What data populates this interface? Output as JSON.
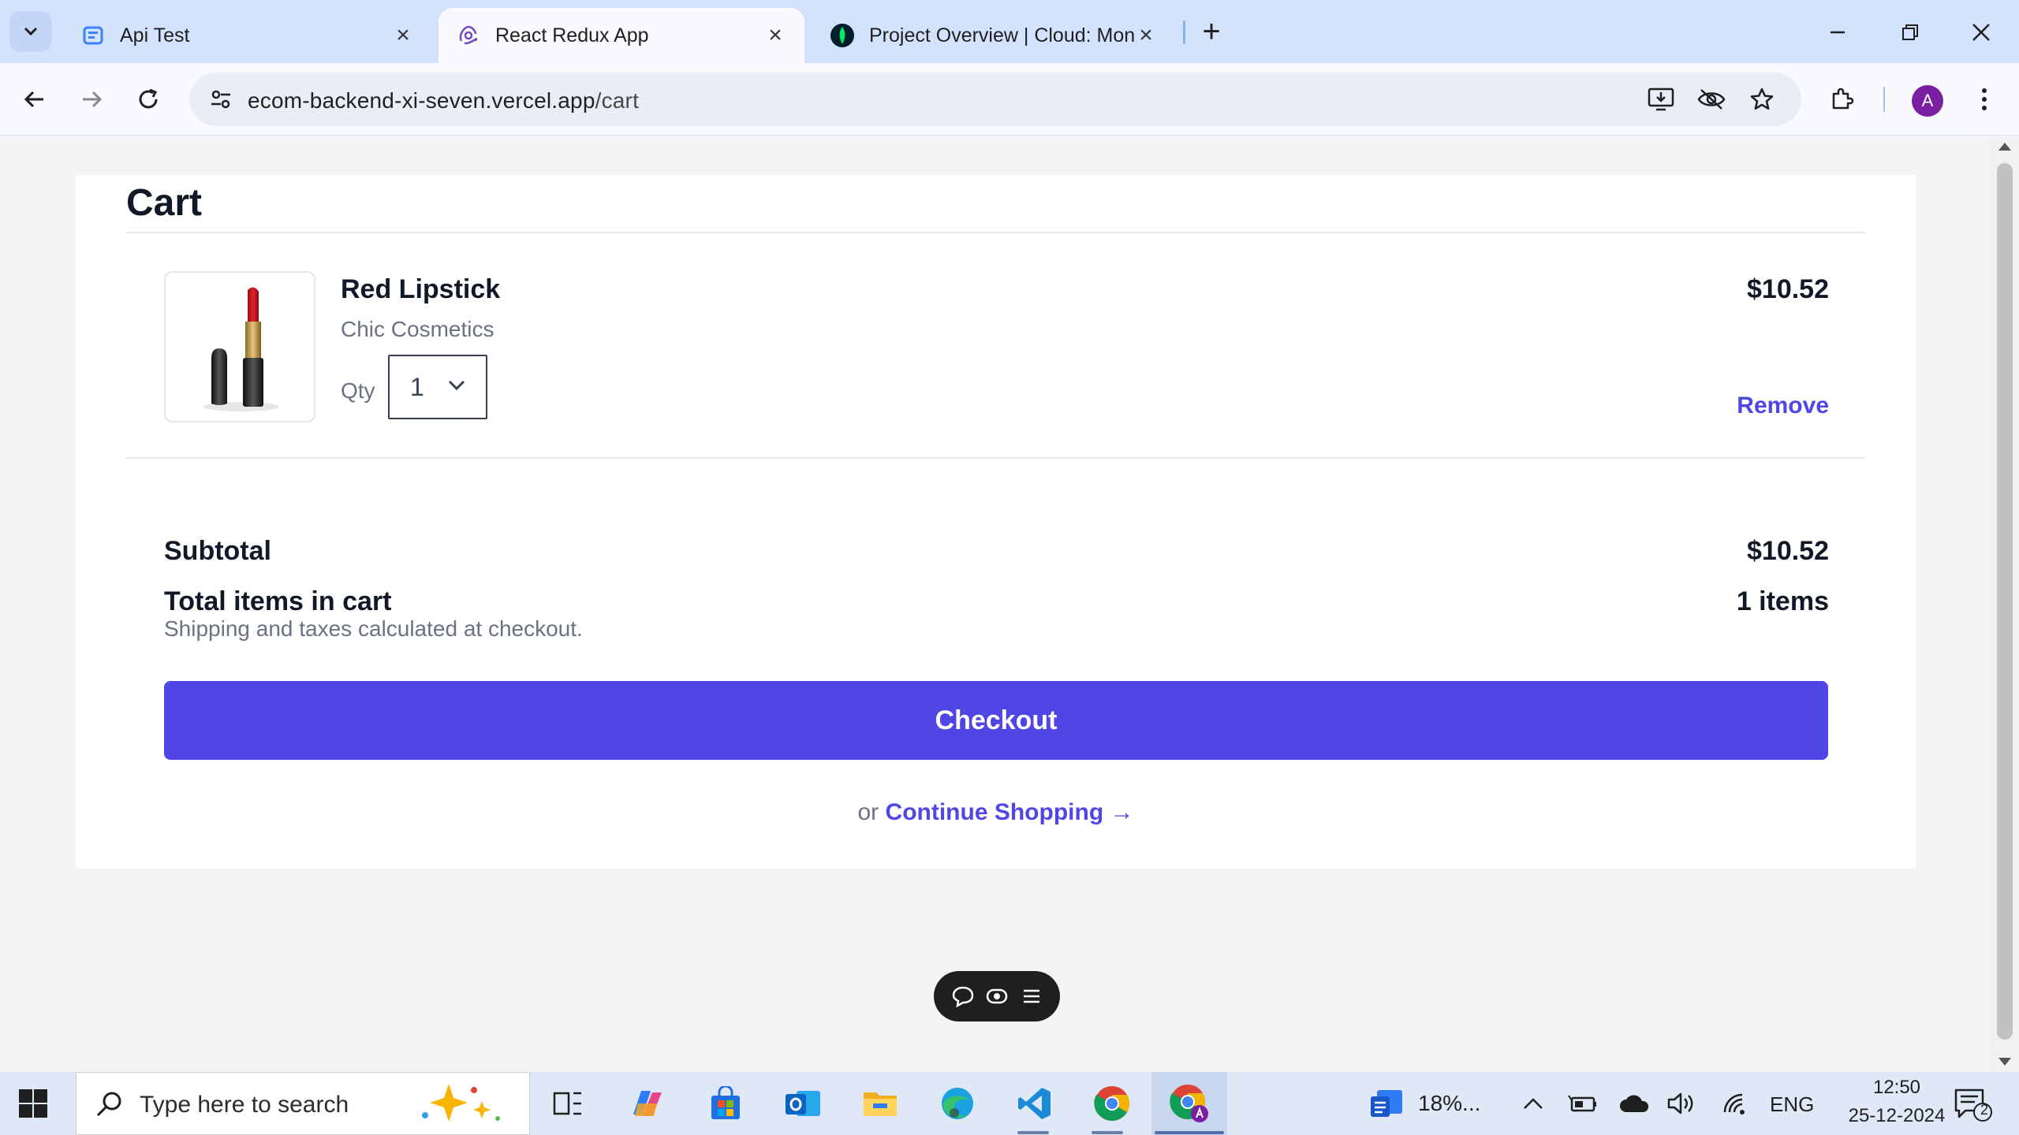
{
  "browser": {
    "tabs": [
      {
        "title": "Api Test",
        "active": false
      },
      {
        "title": "React Redux App",
        "active": true
      },
      {
        "title": "Project Overview | Cloud: Mong",
        "active": false
      }
    ],
    "url_host": "ecom-backend-xi-seven.vercel.app",
    "url_path": "/cart",
    "profile_initial": "A"
  },
  "cart": {
    "title": "Cart",
    "items": [
      {
        "name": "Red Lipstick",
        "brand": "Chic Cosmetics",
        "qty_label": "Qty",
        "qty": "1",
        "price": "$10.52",
        "remove_label": "Remove"
      }
    ],
    "subtotal_label": "Subtotal",
    "subtotal_value": "$10.52",
    "total_items_label": "Total items in cart",
    "total_items_value": "1 items",
    "shipping_note": "Shipping and taxes calculated at checkout.",
    "checkout_label": "Checkout",
    "or_text": "or",
    "continue_label": "Continue Shopping →"
  },
  "taskbar": {
    "search_placeholder": "Type here to search",
    "weather": "18%...",
    "language": "ENG",
    "time": "12:50",
    "date": "25-12-2024",
    "notification_count": "2"
  },
  "colors": {
    "accent": "#4f46e5",
    "tabstrip": "#d3e3fd",
    "profile": "#7b1fa2"
  }
}
